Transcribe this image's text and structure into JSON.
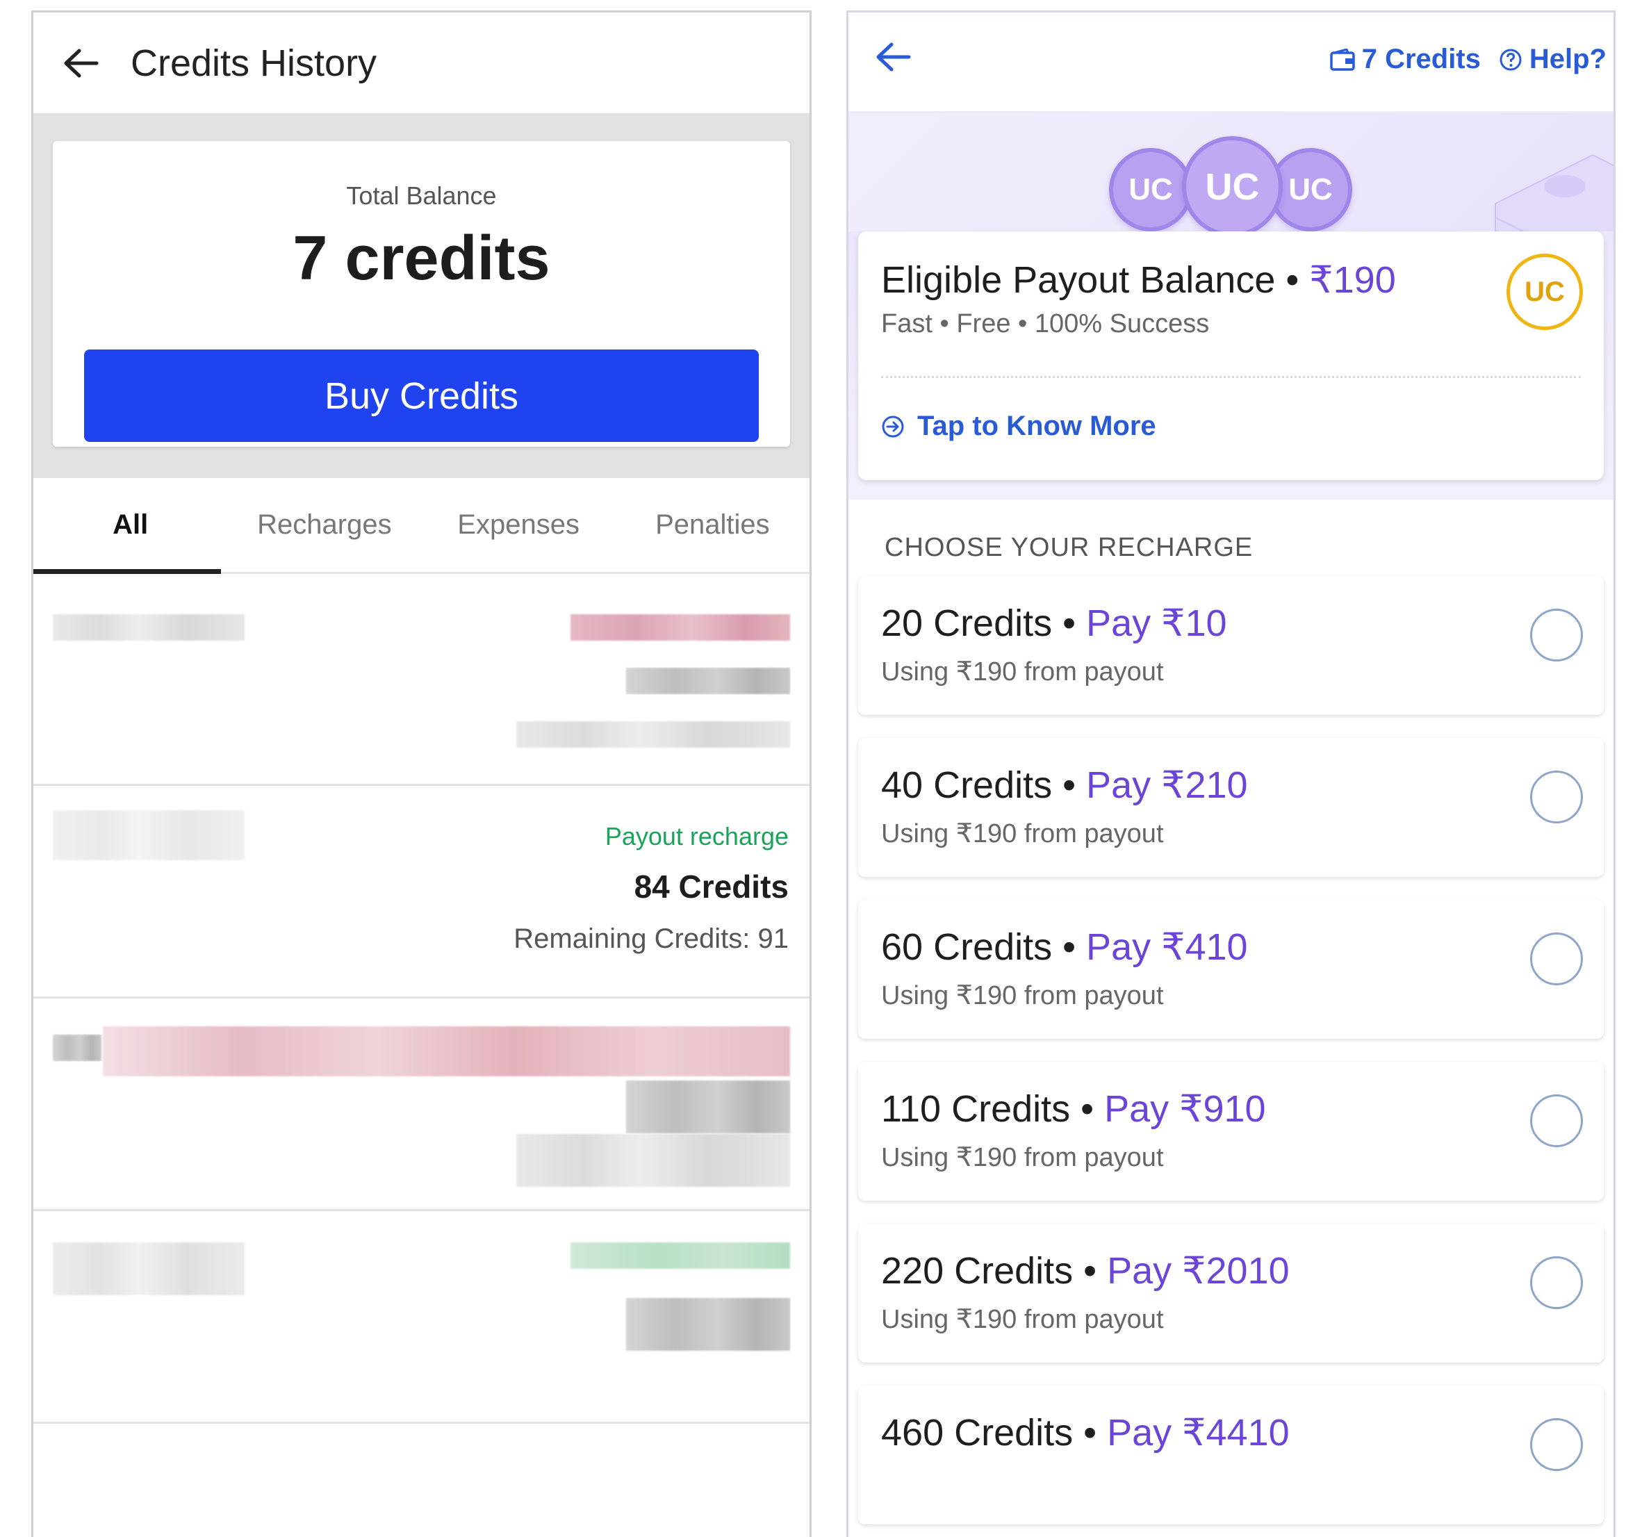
{
  "credits_history": {
    "title": "Credits History",
    "balance_label": "Total Balance",
    "balance_value": "7 credits",
    "buy_button": "Buy Credits",
    "tabs": [
      {
        "label": "All",
        "active": true
      },
      {
        "label": "Recharges",
        "active": false
      },
      {
        "label": "Expenses",
        "active": false
      },
      {
        "label": "Penalties",
        "active": false
      }
    ],
    "transaction": {
      "type": "Payout recharge",
      "amount": "84 Credits",
      "remaining": "Remaining Credits: 91"
    }
  },
  "recharge": {
    "header_credits": "7 Credits",
    "header_help": "Help?",
    "coin_label": "UC",
    "payout_title": "Eligible Payout Balance •",
    "payout_amount": "₹190",
    "payout_sub": "Fast • Free • 100% Success",
    "badge": "UC",
    "know_more": "Tap to Know More",
    "section_title": "CHOOSE YOUR RECHARGE",
    "options": [
      {
        "credits": "20 Credits •",
        "pay": "Pay ₹10",
        "sub": "Using ₹190 from payout"
      },
      {
        "credits": "40 Credits •",
        "pay": "Pay ₹210",
        "sub": "Using ₹190 from payout"
      },
      {
        "credits": "60 Credits •",
        "pay": "Pay ₹410",
        "sub": "Using ₹190 from payout"
      },
      {
        "credits": "110 Credits •",
        "pay": "Pay ₹910",
        "sub": "Using ₹190 from payout"
      },
      {
        "credits": "220 Credits •",
        "pay": "Pay ₹2010",
        "sub": "Using ₹190 from payout"
      },
      {
        "credits": "460 Credits •",
        "pay": "Pay ₹4410",
        "sub": ""
      }
    ]
  },
  "colors": {
    "buy_button": "#1f44ef",
    "accent_blue": "#2a5bd7",
    "accent_purple": "#6b45d8",
    "payout_green": "#1aa35b",
    "badge_gold": "#f0b413"
  }
}
